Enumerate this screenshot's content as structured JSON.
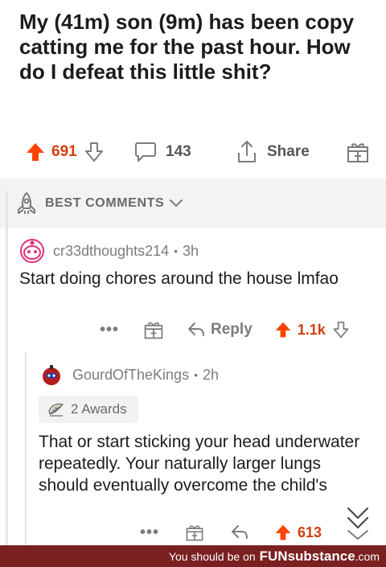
{
  "post": {
    "title": "My (41m) son (9m) has been copy catting me for the past hour. How do I defeat this little shit?",
    "score": "691",
    "comment_count": "143",
    "share_label": "Share"
  },
  "sort": {
    "label": "BEST COMMENTS"
  },
  "comments": [
    {
      "username": "cr33dthoughts214",
      "separator": "•",
      "age": "3h",
      "body": "Start doing chores around the house lmfao",
      "more_label": "•••",
      "reply_label": "Reply",
      "score": "1.1k"
    },
    {
      "username": "GourdOfTheKings",
      "separator": "•",
      "age": "2h",
      "awards_label": "2 Awards",
      "body": "That or start sticking your head underwater repeatedly. Your naturally larger lungs should eventually overcome the child's",
      "more_label": "•••",
      "score": "613"
    }
  ],
  "footer": {
    "prefix": "You should be on",
    "brand": "FUNsubstance",
    "domain": ".com"
  },
  "colors": {
    "upvote": "#ff4500",
    "score": "#d13f0d",
    "footer_bg": "#7a2020"
  }
}
